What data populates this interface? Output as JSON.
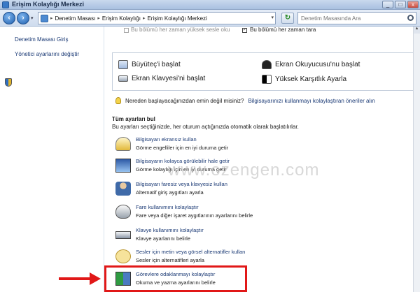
{
  "window": {
    "title": "Erişim Kolaylığı Merkezi",
    "btn_min": "_",
    "btn_max": "□",
    "btn_close": "x"
  },
  "address": {
    "back": "‹",
    "forward": "›",
    "dropdown": "▾",
    "breadcrumbs": [
      "Denetim Masası",
      "Erişim Kolaylığı",
      "Erişim Kolaylığı Merkezi"
    ],
    "separator": "▸",
    "end_arrow": "▾",
    "refresh": "↻",
    "search_placeholder": "Denetim Masasında Ara"
  },
  "sidebar": {
    "items": [
      {
        "label": "Denetim Masası Giriş"
      },
      {
        "label": "Yönetici ayarlarını değiştir",
        "icon": "shield-icon"
      }
    ]
  },
  "top_options": {
    "left_text": "Bu bölümü her zaman yüksek sesle oku",
    "right_check": "✓",
    "right_text": "Bu bölümü her zaman tara"
  },
  "quick_access": [
    {
      "label": "Büyüteç'i başlat",
      "icon": "magnifier-icon"
    },
    {
      "label": "Ekran Okuyucusu'nu başlat",
      "icon": "narrator-icon"
    },
    {
      "label": "Ekran Klavyesi'ni başlat",
      "icon": "keyboard-icon"
    },
    {
      "label": "Yüksek Karşıtlık Ayarla",
      "icon": "contrast-icon"
    }
  ],
  "hint": {
    "question": "Nereden başlayacağınızdan emin değil misiniz?",
    "link": "Bilgisayarınızı kullanmayı kolaylaştıran öneriler alın"
  },
  "section": {
    "title": "Tüm ayarları bul",
    "desc": "Bu ayarları seçtiğinizde, her oturum açtığınızda otomatik olarak başlatılırlar."
  },
  "settings": [
    {
      "title": "Bilgisayarı ekransız kullan",
      "desc": "Görme engelliler için en iyi duruma getir",
      "icon": "monitor-icon"
    },
    {
      "title": "Bilgisayarın kolayca görülebilir hale getir",
      "desc": "Görme kolaylığı için en iyi duruma getir",
      "icon": "screen-icon"
    },
    {
      "title": "Bilgisayarı faresiz veya klavyesiz kullan",
      "desc": "Alternatif giriş aygıtları ayarla",
      "icon": "person-icon"
    },
    {
      "title": "Fare kullanımını kolaylaştır",
      "desc": "Fare veya diğer işaret aygıtlarının ayarlarını belirle",
      "icon": "mouse-icon"
    },
    {
      "title": "Klavye kullanımını kolaylaştır",
      "desc": "Klavye ayarlarını belirle",
      "icon": "keyb-icon"
    },
    {
      "title": "Sesler için metin veya görsel alternatifler kullan",
      "desc": "Sesler için alternatifleri ayarla",
      "icon": "bubble-icon"
    },
    {
      "title": "Görevlere odaklanmayı kolaylaştır",
      "desc": "Okuma ve yazma ayarlarını belirle",
      "icon": "focus-icon"
    }
  ],
  "watermark": "www.ozengen.com",
  "colors": {
    "highlight": "#e11818",
    "link": "#1b3a75"
  }
}
